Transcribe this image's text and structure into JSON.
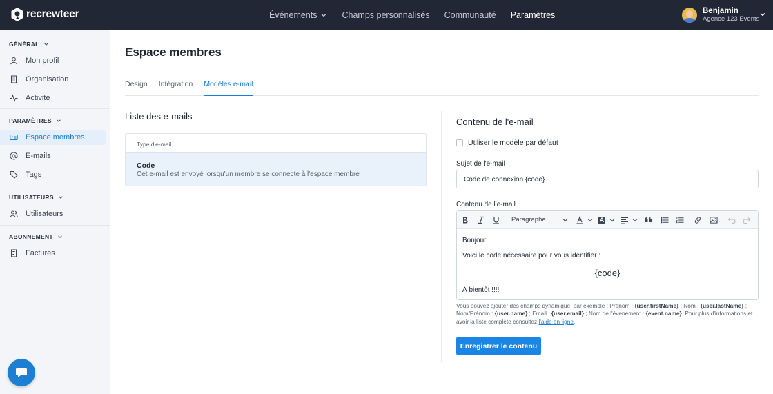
{
  "brand": {
    "name": "recrewteer"
  },
  "topnav": [
    {
      "label": "Événements",
      "has_dropdown": true
    },
    {
      "label": "Champs personnalisés"
    },
    {
      "label": "Communauté"
    },
    {
      "label": "Paramètres",
      "active": true
    }
  ],
  "user": {
    "name": "Benjamin",
    "org": "Agence 123 Events"
  },
  "sidebar": {
    "sections": [
      {
        "title": "GÉNÉRAL",
        "items": [
          {
            "label": "Mon profil",
            "icon": "user-icon"
          },
          {
            "label": "Organisation",
            "icon": "building-icon"
          },
          {
            "label": "Activité",
            "icon": "activity-icon"
          }
        ]
      },
      {
        "title": "PARAMÈTRES",
        "items": [
          {
            "label": "Espace membres",
            "icon": "id-card-icon",
            "active": true
          },
          {
            "label": "E-mails",
            "icon": "at-icon"
          },
          {
            "label": "Tags",
            "icon": "tag-icon"
          }
        ]
      },
      {
        "title": "UTILISATEURS",
        "items": [
          {
            "label": "Utilisateurs",
            "icon": "users-icon"
          }
        ]
      },
      {
        "title": "ABONNEMENT",
        "items": [
          {
            "label": "Factures",
            "icon": "invoice-icon"
          }
        ]
      }
    ]
  },
  "page": {
    "title": "Espace membres",
    "tabs": [
      {
        "label": "Design"
      },
      {
        "label": "Intégration"
      },
      {
        "label": "Modèles e-mail",
        "active": true
      }
    ]
  },
  "list": {
    "title": "Liste des e-mails",
    "header": "Type d'e-mail",
    "rows": [
      {
        "title": "Code",
        "desc": "Cet e-mail est envoyé lorsqu'un membre se connecte à l'espace membre"
      }
    ]
  },
  "content": {
    "title": "Contenu de l'e-mail",
    "default_checkbox": "Utiliser le modèle par défaut",
    "default_checked": false,
    "subject_label": "Sujet de l'e-mail",
    "subject_value": "Code de connexion {code}",
    "body_label": "Contenu de l'e-mail",
    "toolbar": {
      "paragraph": "Paragraphe"
    },
    "body": {
      "line1": "Bonjour,",
      "line2": "Voici le code nécessaire pour vous identifier :",
      "code": "{code}",
      "line4": "À bientôt !!!!"
    },
    "help": {
      "p1": "Vous pouvez ajouter des champs dynamique, par exemple : Prénom : ",
      "f1": "{user.firstName}",
      "p2": " ; Nom : ",
      "f2": "{user.lastName}",
      "p3": " ; Nom/Prénom : ",
      "f3": "{user.name}",
      "p4": " ; Email : ",
      "f4": "{user.email}",
      "p5": " ; Nom de l'évenement : ",
      "f5": "{event.name}",
      "p6": ". Pour plus d'informations et avoir la liste complète consultez ",
      "link": "l'aide en ligne",
      "p7": "."
    },
    "save_button": "Enregistrer le contenu"
  },
  "colors": {
    "topbar": "#212734",
    "accent": "#1a85e4",
    "sidebar_bg": "#f3f5f8",
    "active_row": "#e9f2fb"
  }
}
